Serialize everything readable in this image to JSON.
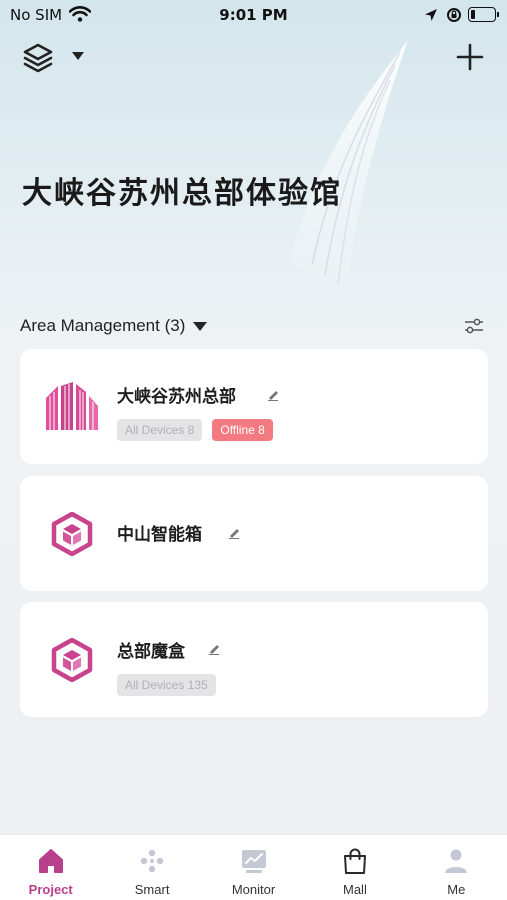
{
  "status_bar": {
    "carrier": "No SIM",
    "time": "9:01 PM"
  },
  "header": {
    "project_title": "大峡谷苏州总部体验馆"
  },
  "area_management": {
    "label": "Area Management (3)",
    "areas": [
      {
        "name": "大峡谷苏州总部",
        "icon": "building-icon",
        "badges": [
          {
            "text": "All Devices 8",
            "style": "gray"
          },
          {
            "text": "Offline 8",
            "style": "red"
          }
        ]
      },
      {
        "name": "中山智能箱",
        "icon": "cube-icon",
        "badges": []
      },
      {
        "name": "总部魔盒",
        "icon": "cube-icon",
        "badges": [
          {
            "text": "All Devices 135",
            "style": "gray"
          }
        ]
      }
    ]
  },
  "tab_bar": {
    "tabs": [
      {
        "label": "Project",
        "icon": "home-icon",
        "active": true
      },
      {
        "label": "Smart",
        "icon": "smart-icon",
        "active": false
      },
      {
        "label": "Monitor",
        "icon": "monitor-icon",
        "active": false
      },
      {
        "label": "Mall",
        "icon": "bag-icon",
        "active": false
      },
      {
        "label": "Me",
        "icon": "person-icon",
        "active": false
      }
    ]
  },
  "colors": {
    "accent": "#b83f8c",
    "offline_badge": "#f27a80",
    "tab_inactive_icon": "#c4c8d4"
  }
}
